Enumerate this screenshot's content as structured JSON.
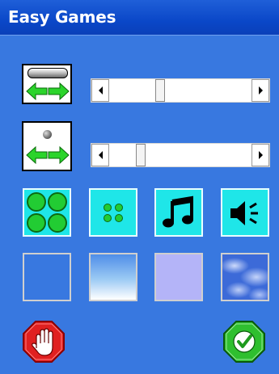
{
  "window": {
    "title": "Easy Games"
  },
  "colors": {
    "background": "#3878e0",
    "titlebar": "#0a47c8",
    "button_active": "#1fe6e8",
    "green": "#22cc33",
    "stop_red": "#e02020",
    "ok_green": "#2fbf2f"
  },
  "sliders": {
    "paddle_size": {
      "icon": "paddle-width-icon",
      "level": 0.35
    },
    "ball_size": {
      "icon": "ball-size-icon",
      "level": 0.2
    }
  },
  "options": [
    {
      "name": "large-balls",
      "icon": "four-large-circles-icon",
      "active": true
    },
    {
      "name": "small-balls",
      "icon": "four-small-dots-icon",
      "active": true
    },
    {
      "name": "music",
      "icon": "music-note-icon",
      "active": true
    },
    {
      "name": "sound",
      "icon": "speaker-icon",
      "active": true
    }
  ],
  "backgrounds": [
    {
      "name": "solid-blue",
      "color": "#3878e0"
    },
    {
      "name": "gradient-blue",
      "color": "#6aa8f0"
    },
    {
      "name": "lavender",
      "color": "#b4b4f8"
    },
    {
      "name": "clouds",
      "color": "#4f7fe0"
    }
  ],
  "actions": {
    "cancel_icon": "stop-hand-icon",
    "ok_icon": "checkmark-icon"
  }
}
